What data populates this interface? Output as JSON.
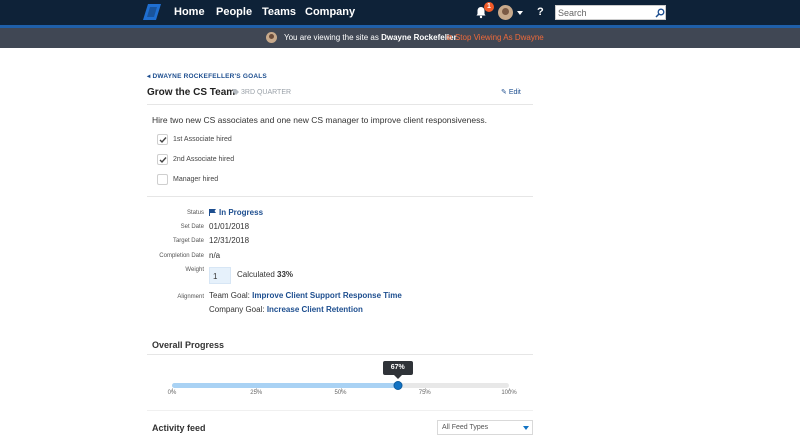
{
  "nav": {
    "links": [
      "Home",
      "People",
      "Teams",
      "Company"
    ],
    "notification_count": "1",
    "help": "?",
    "search_placeholder": "Search"
  },
  "impersonation": {
    "prefix": "You are viewing the site as ",
    "user": "Dwayne Rockefeller",
    "suffix": ".",
    "stop": "Stop Viewing As Dwayne"
  },
  "goal": {
    "back": "DWAYNE ROCKEFELLER'S GOALS",
    "title": "Grow the CS Team",
    "quarter": "3RD QUARTER",
    "edit": "Edit",
    "description": "Hire two new CS associates and one new CS manager to improve client responsiveness.",
    "checklist": [
      {
        "label": "1st Associate hired",
        "checked": true
      },
      {
        "label": "2nd Associate hired",
        "checked": true
      },
      {
        "label": "Manager hired",
        "checked": false
      }
    ]
  },
  "properties": {
    "status_label": "Status",
    "status_value": "In Progress",
    "set_date_label": "Set Date",
    "set_date_value": "01/01/2018",
    "target_date_label": "Target Date",
    "target_date_value": "12/31/2018",
    "completion_date_label": "Completion Date",
    "completion_date_value": "n/a",
    "weight_label": "Weight",
    "weight_value": "1",
    "calculated_prefix": "Calculated ",
    "calculated_value": "33%",
    "alignment_label": "Alignment",
    "team_goal_prefix": "Team Goal: ",
    "team_goal": "Improve Client Support Response Time",
    "company_goal_prefix": "Company Goal: ",
    "company_goal": "Increase Client Retention"
  },
  "progress": {
    "title": "Overall Progress",
    "value": 67,
    "value_label": "67%",
    "ticks": [
      "0%",
      "25%",
      "50%",
      "75%",
      "100%"
    ]
  },
  "activity": {
    "title": "Activity feed",
    "filter": "All Feed Types"
  },
  "colors": {
    "nav_bg": "#0e2238",
    "accent": "#1273c4",
    "link": "#1d4e8f",
    "stop_link": "#ef6a3a"
  }
}
